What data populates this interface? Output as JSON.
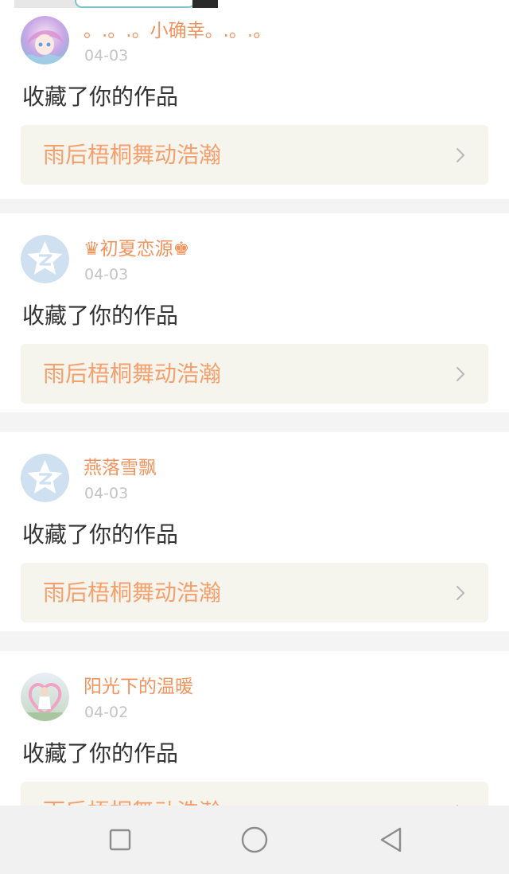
{
  "feed": {
    "items": [
      {
        "user_name": "。.。.。小确幸。.。.。",
        "date": "04-03",
        "action": "收藏了你的作品",
        "work_title": "雨后梧桐舞动浩瀚",
        "avatar_icon": "anime-girl-avatar-icon"
      },
      {
        "user_name": "♛初夏恋源♚",
        "date": "04-03",
        "action": "收藏了你的作品",
        "work_title": "雨后梧桐舞动浩瀚",
        "avatar_icon": "default-star-avatar-icon"
      },
      {
        "user_name": "燕落雪飘",
        "date": "04-03",
        "action": "收藏了你的作品",
        "work_title": "雨后梧桐舞动浩瀚",
        "avatar_icon": "default-star-avatar-icon"
      },
      {
        "user_name": "阳光下的温暖",
        "date": "04-02",
        "action": "收藏了你的作品",
        "work_title": "雨后梧桐舞动浩瀚",
        "avatar_icon": "photo-avatar-icon"
      }
    ]
  },
  "navbar": {
    "recents_icon": "square-icon",
    "home_icon": "circle-icon",
    "back_icon": "triangle-back-icon"
  },
  "colors": {
    "name": "#f0935c",
    "work_title": "#f3a06e",
    "date": "#c4c4c4",
    "action": "#333333",
    "work_bg": "#f6f5ed",
    "separator": "#f4f4f4",
    "default_avatar": "#cfe0f1"
  }
}
